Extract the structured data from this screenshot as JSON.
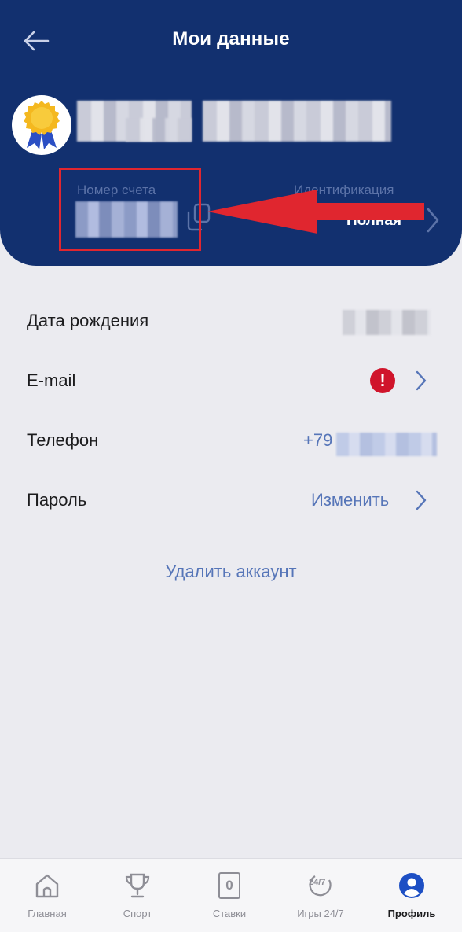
{
  "header": {
    "title": "Мои данные",
    "account": {
      "label": "Номер счета"
    },
    "identification": {
      "label": "Идентификация",
      "value": "Полная"
    }
  },
  "fields": [
    {
      "label": "Дата рождения"
    },
    {
      "label": "E-mail",
      "status_icon": "alert-icon",
      "status_text": "!"
    },
    {
      "label": "Телефон",
      "value_prefix": "+79"
    },
    {
      "label": "Пароль",
      "action": "Изменить"
    }
  ],
  "delete_account": "Удалить аккаунт",
  "tabs": [
    {
      "label": "Главная",
      "icon": "home-icon"
    },
    {
      "label": "Спорт",
      "icon": "trophy-icon"
    },
    {
      "label": "Ставки",
      "icon": "bet-slip-icon",
      "badge": "0"
    },
    {
      "label": "Игры 24/7",
      "icon": "games-24-7-icon",
      "icon_text": "24/7"
    },
    {
      "label": "Профиль",
      "icon": "profile-icon",
      "active": true
    }
  ],
  "colors": {
    "header_bg": "#12306f",
    "accent_link": "#5675b8",
    "alert": "#d0142b",
    "annotation": "#e0262f",
    "page_bg": "#ebebf0"
  }
}
